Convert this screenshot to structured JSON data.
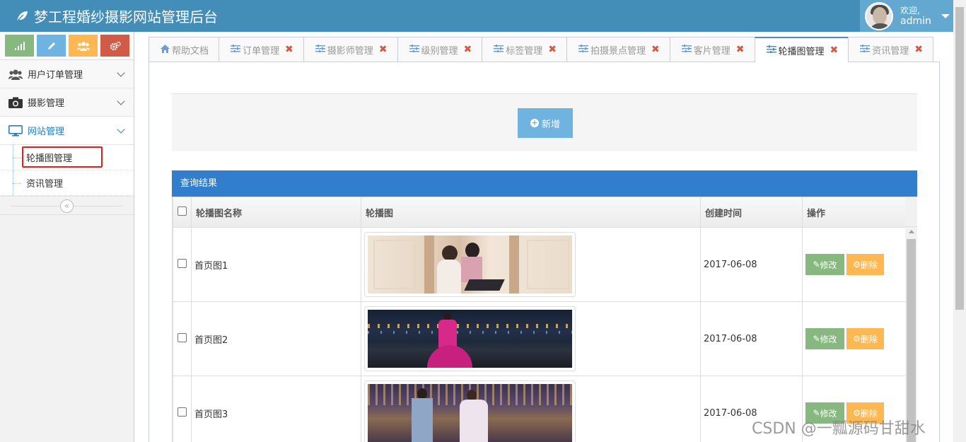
{
  "app": {
    "title": "梦工程婚纱摄影网站管理后台"
  },
  "user": {
    "welcome": "欢迎,",
    "name": "admin"
  },
  "sidebar": {
    "shortcuts": [
      "signal-icon",
      "pencil-icon",
      "users-icon",
      "cogs-icon"
    ],
    "menu": [
      {
        "label": "用户订单管理",
        "icon": "users-icon"
      },
      {
        "label": "摄影管理",
        "icon": "camera-icon"
      },
      {
        "label": "网站管理",
        "icon": "desktop-icon"
      }
    ],
    "submenu": [
      {
        "label": "轮播图管理"
      },
      {
        "label": "资讯管理"
      }
    ],
    "collapse": "«"
  },
  "tabs": [
    {
      "label": "帮助文档",
      "icon": "home-icon",
      "closable": false
    },
    {
      "label": "订单管理",
      "icon": "sliders-icon",
      "closable": true
    },
    {
      "label": "摄影师管理",
      "icon": "sliders-icon",
      "closable": true
    },
    {
      "label": "级别管理",
      "icon": "sliders-icon",
      "closable": true
    },
    {
      "label": "标签管理",
      "icon": "sliders-icon",
      "closable": true
    },
    {
      "label": "拍摄景点管理",
      "icon": "sliders-icon",
      "closable": true
    },
    {
      "label": "客片管理",
      "icon": "sliders-icon",
      "closable": true
    },
    {
      "label": "轮播图管理",
      "icon": "sliders-icon",
      "closable": true,
      "active": true
    },
    {
      "label": "资讯管理",
      "icon": "sliders-icon",
      "closable": true
    }
  ],
  "toolbar": {
    "add_label": "新增"
  },
  "results": {
    "title": "查询结果",
    "columns": [
      "轮播图名称",
      "轮播图",
      "创建时间",
      "操作"
    ],
    "rows": [
      {
        "name": "首页图1",
        "date": "2017-06-08"
      },
      {
        "name": "首页图2",
        "date": "2017-06-08"
      },
      {
        "name": "首页图3",
        "date": "2017-06-08"
      }
    ],
    "edit_label": "修改",
    "delete_label": "删除"
  },
  "watermark": "CSDN @一瓢源码甘甜水",
  "colors": {
    "navbar": "#438eb9",
    "result_header": "#307ecc",
    "edit": "#87b87f",
    "delete": "#ffb752",
    "add": "#6fb3e0"
  }
}
